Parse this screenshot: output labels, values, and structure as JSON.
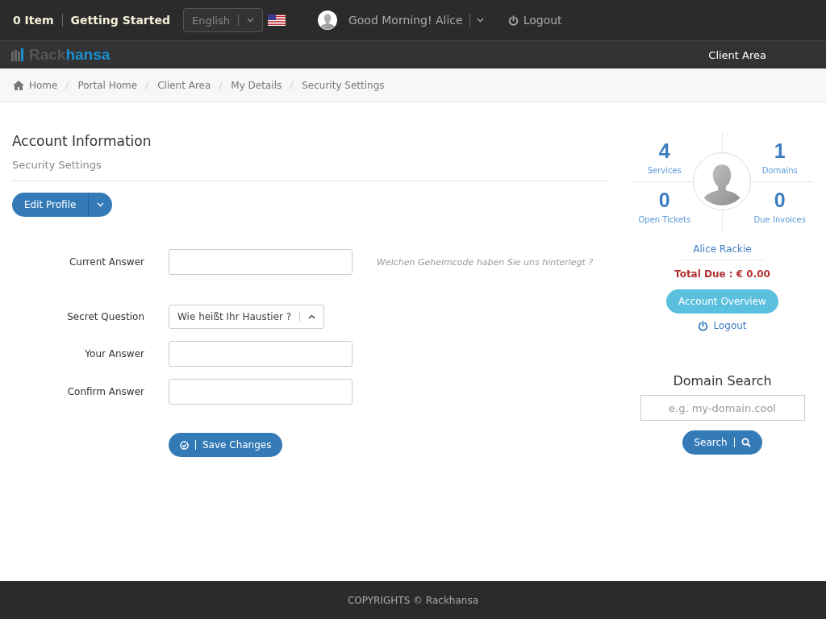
{
  "top_bar": {
    "cart": "0 Item",
    "getting_started": "Getting Started",
    "language": "English",
    "greeting": "Good Morning! Alice",
    "logout": "Logout"
  },
  "brand": {
    "logo_first": "Rack",
    "logo_second": "hansa",
    "client_area": "Client Area"
  },
  "breadcrumb": [
    "Home",
    "Portal Home",
    "Client Area",
    "My Details",
    "Security Settings"
  ],
  "page": {
    "title": "Account Information",
    "subtitle": "Security Settings",
    "edit_button": "Edit Profile"
  },
  "form": {
    "groups": [
      {
        "rows": [
          {
            "kind": "text",
            "label": "Current Answer",
            "hint": "Welchen Geheimcode haben Sie uns hinterlegt ?"
          }
        ]
      },
      {
        "rows": [
          {
            "kind": "select",
            "label": "Secret Question",
            "value": "Wie heißt Ihr Haustier ?"
          },
          {
            "kind": "text",
            "label": "Your Answer"
          },
          {
            "kind": "text",
            "label": "Confirm Answer"
          }
        ]
      }
    ],
    "save_button": "Save Changes"
  },
  "sidebar": {
    "stats": [
      {
        "value": "4",
        "label": "Services"
      },
      {
        "value": "1",
        "label": "Domains"
      },
      {
        "value": "0",
        "label": "Open Tickets"
      },
      {
        "value": "0",
        "label": "Due Invoices"
      }
    ],
    "name": "Alice Rackie",
    "total_due": "Total Due : € 0.00",
    "overview_button": "Account Overview",
    "logout": "Logout",
    "domain_search": {
      "title": "Domain Search",
      "placeholder": "e.g. my-domain.cool",
      "button": "Search"
    }
  },
  "footer": "COPYRIGHTS © Rackhansa"
}
